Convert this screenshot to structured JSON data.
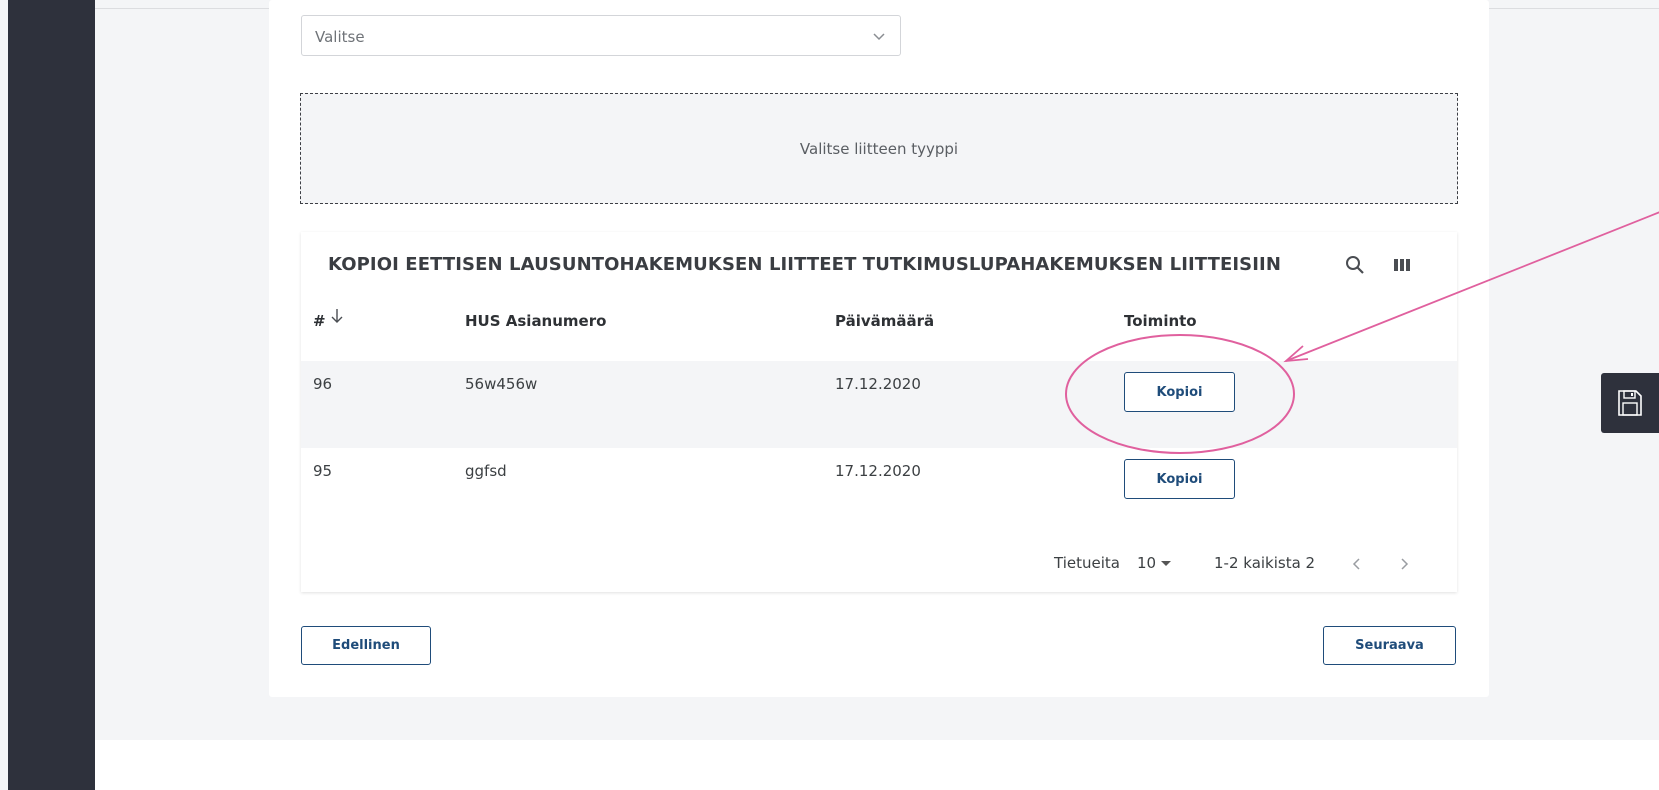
{
  "form": {
    "select_value": "Valitse",
    "dropzone_text": "Valitse liitteen tyyppi"
  },
  "table": {
    "title": "KOPIOI EETTISEN LAUSUNTOHAKEMUKSEN LIITTEET TUTKIMUSLUPAHAKEMUKSEN LIITTEISIIN",
    "columns": {
      "number": "#",
      "case_number": "HUS Asianumero",
      "date": "Päivämäärä",
      "action": "Toiminto"
    },
    "rows": [
      {
        "number": "96",
        "case_number": "56w456w",
        "date": "17.12.2020",
        "action_label": "Kopioi"
      },
      {
        "number": "95",
        "case_number": "ggfsd",
        "date": "17.12.2020",
        "action_label": "Kopioi"
      }
    ],
    "pagination": {
      "rows_label": "Tietueita",
      "rows_per_page": "10",
      "range": "1-2 kaikista 2"
    }
  },
  "navigation": {
    "previous_label": "Edellinen",
    "next_label": "Seuraava"
  },
  "colors": {
    "sidebar": "#2e313c",
    "button_accent": "#1f4c7a",
    "annotation": "#e0609e"
  },
  "icons": {
    "select_chevron": "chevron-down-icon",
    "search": "search-icon",
    "columns": "columns-icon",
    "sort": "arrow-down-icon",
    "save": "floppy-disk-icon"
  }
}
